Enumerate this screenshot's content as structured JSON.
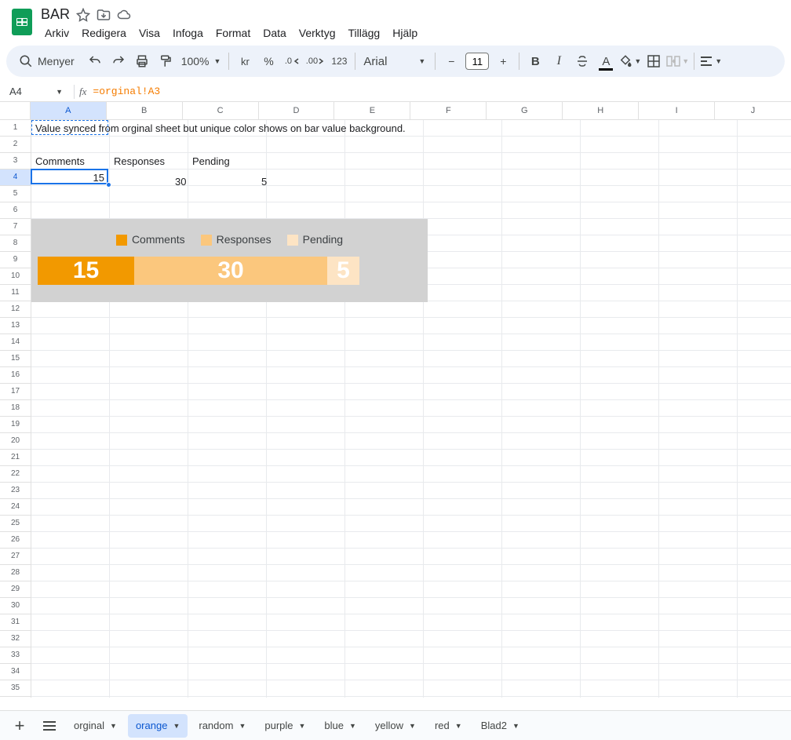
{
  "doc": {
    "title": "BAR"
  },
  "menus": [
    "Arkiv",
    "Redigera",
    "Visa",
    "Infoga",
    "Format",
    "Data",
    "Verktyg",
    "Tillägg",
    "Hjälp"
  ],
  "toolbar": {
    "search_label": "Menyer",
    "zoom": "100%",
    "currency": "kr",
    "percent": "%",
    "n123": "123",
    "font": "Arial",
    "font_size": "11",
    "dec_less": ".0",
    "dec_more": ".00"
  },
  "fx": {
    "cell": "A4",
    "formula": "=orginal!A3"
  },
  "columns": [
    "A",
    "B",
    "C",
    "D",
    "E",
    "F",
    "G",
    "H",
    "I",
    "J"
  ],
  "rows_count": 35,
  "cells": {
    "A1": "Value synced from orginal sheet but unique color shows on bar value background.",
    "A3": "Comments",
    "B3": "Responses",
    "C3": "Pending",
    "A4": "15",
    "B4": "30",
    "C4": "5"
  },
  "chart_data": {
    "type": "bar",
    "orientation": "stacked-horizontal",
    "categories": [
      "Comments",
      "Responses",
      "Pending"
    ],
    "values": [
      15,
      30,
      5
    ],
    "colors": [
      "#f29900",
      "#fbc77d",
      "#fde4c4"
    ],
    "background": "#d2d2d2",
    "title": "",
    "xlabel": "",
    "ylabel": ""
  },
  "sheets": {
    "list": [
      "orginal",
      "orange",
      "random",
      "purple",
      "blue",
      "yellow",
      "red",
      "Blad2"
    ],
    "active": "orange"
  }
}
